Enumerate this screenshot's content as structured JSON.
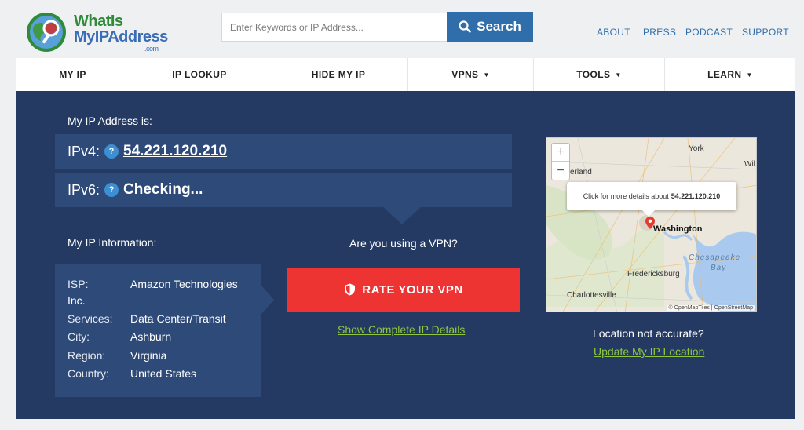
{
  "logo": {
    "line1": "WhatIs",
    "line2": "MyIPAddress",
    "line3": ".com"
  },
  "search": {
    "placeholder": "Enter Keywords or IP Address...",
    "button_label": "Search"
  },
  "top_links": [
    "ABOUT",
    "PRESS",
    "PODCAST",
    "SUPPORT"
  ],
  "nav": [
    {
      "label": "MY IP",
      "dropdown": false
    },
    {
      "label": "IP LOOKUP",
      "dropdown": false
    },
    {
      "label": "HIDE MY IP",
      "dropdown": false
    },
    {
      "label": "VPNS",
      "dropdown": true
    },
    {
      "label": "TOOLS",
      "dropdown": true
    },
    {
      "label": "LEARN",
      "dropdown": true
    }
  ],
  "main": {
    "heading": "My IP Address is:",
    "ipv4_label": "IPv4:",
    "ipv4_value": "54.221.120.210",
    "ipv6_label": "IPv6:",
    "ipv6_value": "Checking...",
    "help_symbol": "?",
    "info_heading": "My IP Information:",
    "isp_label": "ISP:",
    "isp_value_line1": "Amazon Technologies",
    "isp_value_line2": "Inc.",
    "services_label": "Services:",
    "services_value": "Data Center/Transit",
    "city_label": "City:",
    "city_value": "Ashburn",
    "region_label": "Region:",
    "region_value": "Virginia",
    "country_label": "Country:",
    "country_value": "United States",
    "vpn_question": "Are you using a VPN?",
    "rate_vpn_label": "RATE YOUR VPN",
    "complete_details_link": "Show Complete IP Details",
    "location_question": "Location not accurate?",
    "update_location_link": "Update My IP Location"
  },
  "map": {
    "zoom_in": "+",
    "zoom_out": "−",
    "tooltip_text": "Click for more details about",
    "tooltip_ip": "54.221.120.210",
    "labels": [
      "York",
      "erland",
      "Wil",
      "Washington",
      "Chesapeake",
      "Bay",
      "Fredericksburg",
      "Charlottesville"
    ],
    "attribution": "© OpenMapTiles | OpenStreetMap"
  },
  "colors": {
    "panel": "#243a63",
    "row": "#2e4a78",
    "accent_blue": "#2f6eaa",
    "rate_red": "#ee3333",
    "link_green": "#8ec63f"
  }
}
